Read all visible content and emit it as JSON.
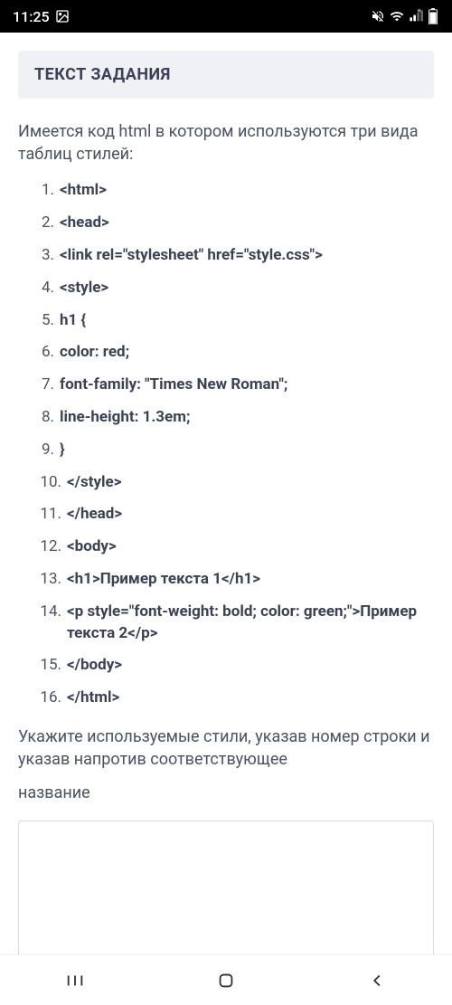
{
  "statusbar": {
    "time": "11:25"
  },
  "header": {
    "title": "ТЕКСТ ЗАДАНИЯ"
  },
  "intro": "Имеется код html в котором используются три вида таблиц стилей:",
  "code_lines": [
    "<html>",
    "<head>",
    "<link rel=\"stylesheet\" href=\"style.css\">",
    "<style>",
    "h1 {",
    "color: red;",
    "font-family: \"Times New Roman\";",
    "line-height: 1.3em;",
    "}",
    "</style>",
    "</head>",
    "<body>",
    "<h1>Пример текста 1</h1>",
    "<p style=\"font-weight: bold; color: green;\">Пример текста 2</p>",
    "</body>",
    "</html>"
  ],
  "outro1": "Укажите используемые стили, указав номер строки и указав напротив соответствующее",
  "outro2": "название",
  "answer": {
    "placeholder": ""
  }
}
